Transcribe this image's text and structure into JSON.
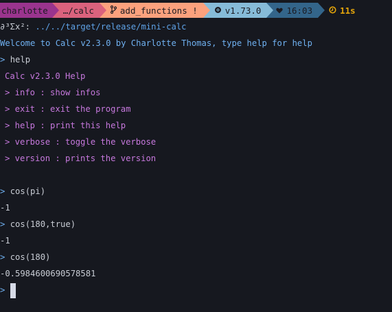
{
  "prompt": {
    "user": "charlotte",
    "user_prefix": "",
    "dir": "…/calc",
    "branch": "add_functions !",
    "branch_icon": "git-branch-icon",
    "rust": "v1.73.0",
    "rust_icon": "rust-gear-icon",
    "time": "16:03",
    "time_icon": "heart-icon",
    "duration": "11s",
    "duration_icon": "clock-icon",
    "colors": {
      "user": "#9a348e",
      "dir": "#da627d",
      "git": "#fca17d",
      "rust": "#86bbd8",
      "time": "#33658a",
      "duration": "#e5a50a"
    }
  },
  "command_line": {
    "prompt_symbol": "∂³Σx²:",
    "path": " ../../target/release/mini-calc"
  },
  "welcome": "Welcome to Calc v2.3.0 by Charlotte Thomas, type help for help",
  "lines": [
    {
      "kind": "input",
      "text": "help"
    },
    {
      "kind": "help-title",
      "text": "Calc v2.3.0 Help"
    },
    {
      "kind": "help-item",
      "text": "> info : show infos"
    },
    {
      "kind": "help-item",
      "text": "> exit : exit the program"
    },
    {
      "kind": "help-item",
      "text": "> help : print this help"
    },
    {
      "kind": "help-item",
      "text": "> verbose : toggle the verbose"
    },
    {
      "kind": "help-item",
      "text": "> version : prints the version"
    },
    {
      "kind": "input",
      "text": "cos(pi)"
    },
    {
      "kind": "output",
      "text": "-1"
    },
    {
      "kind": "input",
      "text": "cos(180,true)"
    },
    {
      "kind": "output",
      "text": "-1"
    },
    {
      "kind": "input",
      "text": "cos(180)"
    },
    {
      "kind": "output",
      "text": "-0.5984600690578581"
    }
  ],
  "input_prompt": ">"
}
